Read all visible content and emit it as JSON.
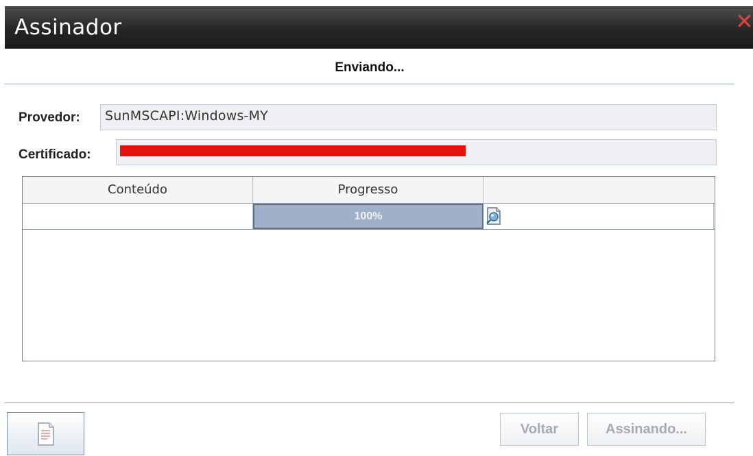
{
  "window": {
    "title": "Assinador",
    "close_glyph": "✕"
  },
  "status_text": "Enviando...",
  "provider": {
    "label": "Provedor:",
    "value": "SunMSCAPI:Windows-MY"
  },
  "certificate": {
    "label": "Certificado:",
    "value_redacted": true
  },
  "table": {
    "columns": [
      "Conteúdo",
      "Progresso",
      ""
    ],
    "rows": [
      {
        "content": "",
        "progress": 1.0,
        "progress_label": "100%",
        "action_icon": "view-document-icon"
      }
    ]
  },
  "buttons": {
    "document_icon": "document-icon",
    "back": "Voltar",
    "sign": "Assinando..."
  },
  "colors": {
    "title_bar": "#262626",
    "close": "#d9433a",
    "progress_fill": "#9fb1c8",
    "redaction": "#e3120f"
  }
}
